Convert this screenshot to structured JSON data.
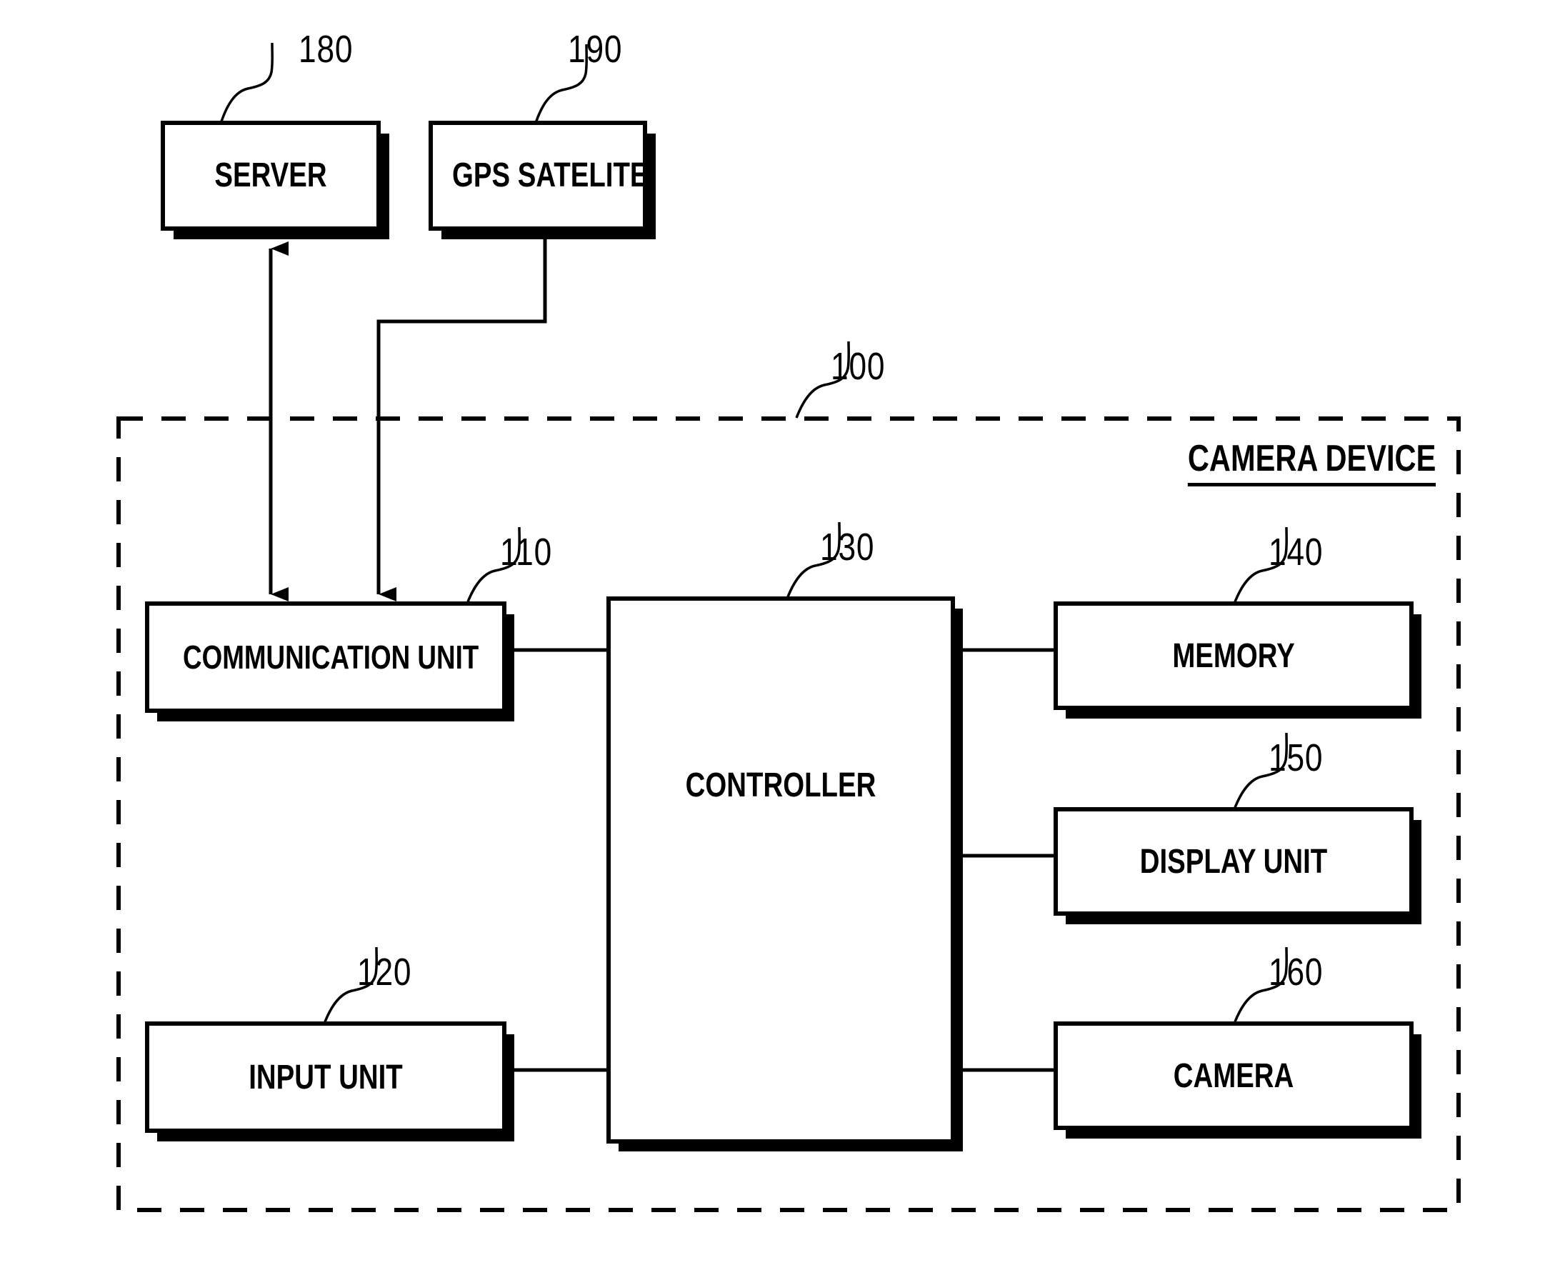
{
  "figure": {
    "type": "patent-block-diagram",
    "external_blocks": [
      {
        "id": "server",
        "label": "SERVER",
        "ref": "180"
      },
      {
        "id": "gps_satelite",
        "label": "GPS SATELITE",
        "ref": "190"
      }
    ],
    "device_boundary": {
      "title": "CAMERA DEVICE",
      "ref": "100",
      "style": "dashed"
    },
    "internal_blocks": [
      {
        "id": "communication_unit",
        "label": "COMMUNICATION UNIT",
        "ref": "110"
      },
      {
        "id": "input_unit",
        "label": "INPUT UNIT",
        "ref": "120"
      },
      {
        "id": "controller",
        "label": "CONTROLLER",
        "ref": "130"
      },
      {
        "id": "memory",
        "label": "MEMORY",
        "ref": "140"
      },
      {
        "id": "display_unit",
        "label": "DISPLAY UNIT",
        "ref": "150"
      },
      {
        "id": "camera",
        "label": "CAMERA",
        "ref": "160"
      }
    ],
    "connections": [
      {
        "from": "server",
        "to": "communication_unit",
        "arrow": "bidirectional"
      },
      {
        "from": "gps_satelite",
        "to": "communication_unit",
        "arrow": "unidirectional"
      },
      {
        "from": "communication_unit",
        "to": "controller",
        "arrow": "none"
      },
      {
        "from": "input_unit",
        "to": "controller",
        "arrow": "none"
      },
      {
        "from": "controller",
        "to": "memory",
        "arrow": "none"
      },
      {
        "from": "controller",
        "to": "display_unit",
        "arrow": "none"
      },
      {
        "from": "controller",
        "to": "camera",
        "arrow": "none"
      }
    ],
    "colors": {
      "stroke": "#000000",
      "fill": "#ffffff",
      "background": "#ffffff"
    }
  }
}
